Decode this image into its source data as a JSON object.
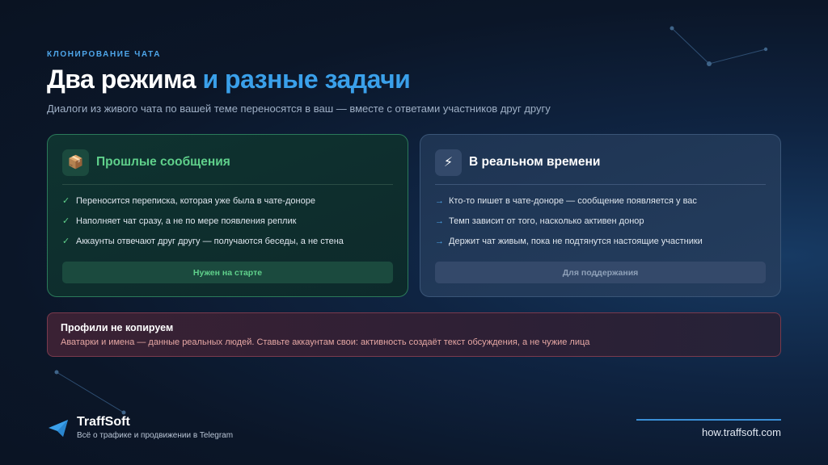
{
  "header": {
    "eyebrow": "КЛОНИРОВАНИЕ ЧАТА",
    "title_main": "Два режима",
    "title_accent": "и разные задачи",
    "subtitle": "Диалоги из живого чата по вашей теме переносятся в ваш — вместе с ответами участников друг другу"
  },
  "cards": [
    {
      "icon": "package-icon",
      "icon_glyph": "📦",
      "title": "Прошлые сообщения",
      "marker": "✓",
      "items": [
        "Переносится переписка, которая уже была в чате-доноре",
        "Наполняет чат сразу, а не по мере появления реплик",
        "Аккаунты отвечают друг другу — получаются беседы, а не стена"
      ],
      "pill": "Нужен на старте"
    },
    {
      "icon": "lightning-icon",
      "icon_glyph": "⚡",
      "title": "В реальном времени",
      "marker": "→",
      "items": [
        "Кто-то пишет в чате-доноре — сообщение появляется у вас",
        "Темп зависит от того, насколько активен донор",
        "Держит чат живым, пока не подтянутся настоящие участники"
      ],
      "pill": "Для поддержания"
    }
  ],
  "note": {
    "title": "Профили не копируем",
    "text": "Аватарки и имена — данные реальных людей. Ставьте аккаунтам свои: активность создаёт текст обсуждения, а не чужие лица"
  },
  "footer": {
    "brand": "TraffSoft",
    "tagline": "Всё о трафике и продвижении в Telegram",
    "url": "how.traffsoft.com"
  },
  "colors": {
    "accent": "#3aa0ea",
    "green": "#5fd08b",
    "note_border": "#7a3a4d"
  }
}
